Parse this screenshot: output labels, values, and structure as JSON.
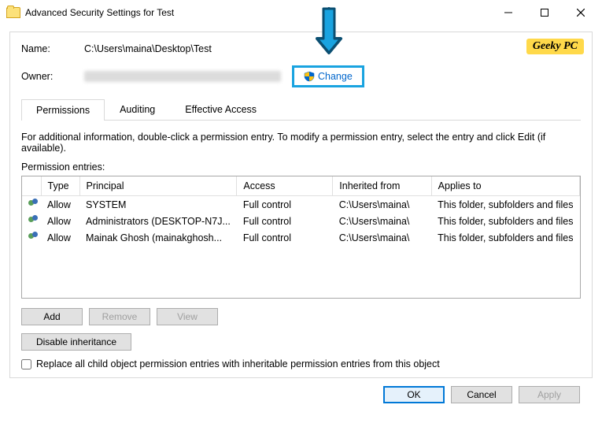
{
  "window": {
    "title": "Advanced Security Settings for Test"
  },
  "watermark": "Geeky PC",
  "fields": {
    "name_label": "Name:",
    "name_value": "C:\\Users\\maina\\Desktop\\Test",
    "owner_label": "Owner:",
    "change_link": "Change"
  },
  "tabs": {
    "permissions": "Permissions",
    "auditing": "Auditing",
    "effective": "Effective Access"
  },
  "info": "For additional information, double-click a permission entry. To modify a permission entry, select the entry and click Edit (if available).",
  "entries_label": "Permission entries:",
  "columns": {
    "blank": "",
    "type": "Type",
    "principal": "Principal",
    "access": "Access",
    "inherited": "Inherited from",
    "applies": "Applies to"
  },
  "rows": [
    {
      "type": "Allow",
      "principal": "SYSTEM",
      "access": "Full control",
      "inherited": "C:\\Users\\maina\\",
      "applies": "This folder, subfolders and files"
    },
    {
      "type": "Allow",
      "principal": "Administrators (DESKTOP-N7J...",
      "access": "Full control",
      "inherited": "C:\\Users\\maina\\",
      "applies": "This folder, subfolders and files"
    },
    {
      "type": "Allow",
      "principal": "Mainak Ghosh (mainakghosh...",
      "access": "Full control",
      "inherited": "C:\\Users\\maina\\",
      "applies": "This folder, subfolders and files"
    }
  ],
  "buttons": {
    "add": "Add",
    "remove": "Remove",
    "view": "View",
    "disable": "Disable inheritance",
    "ok": "OK",
    "cancel": "Cancel",
    "apply": "Apply"
  },
  "checkbox_label": "Replace all child object permission entries with inheritable permission entries from this object"
}
